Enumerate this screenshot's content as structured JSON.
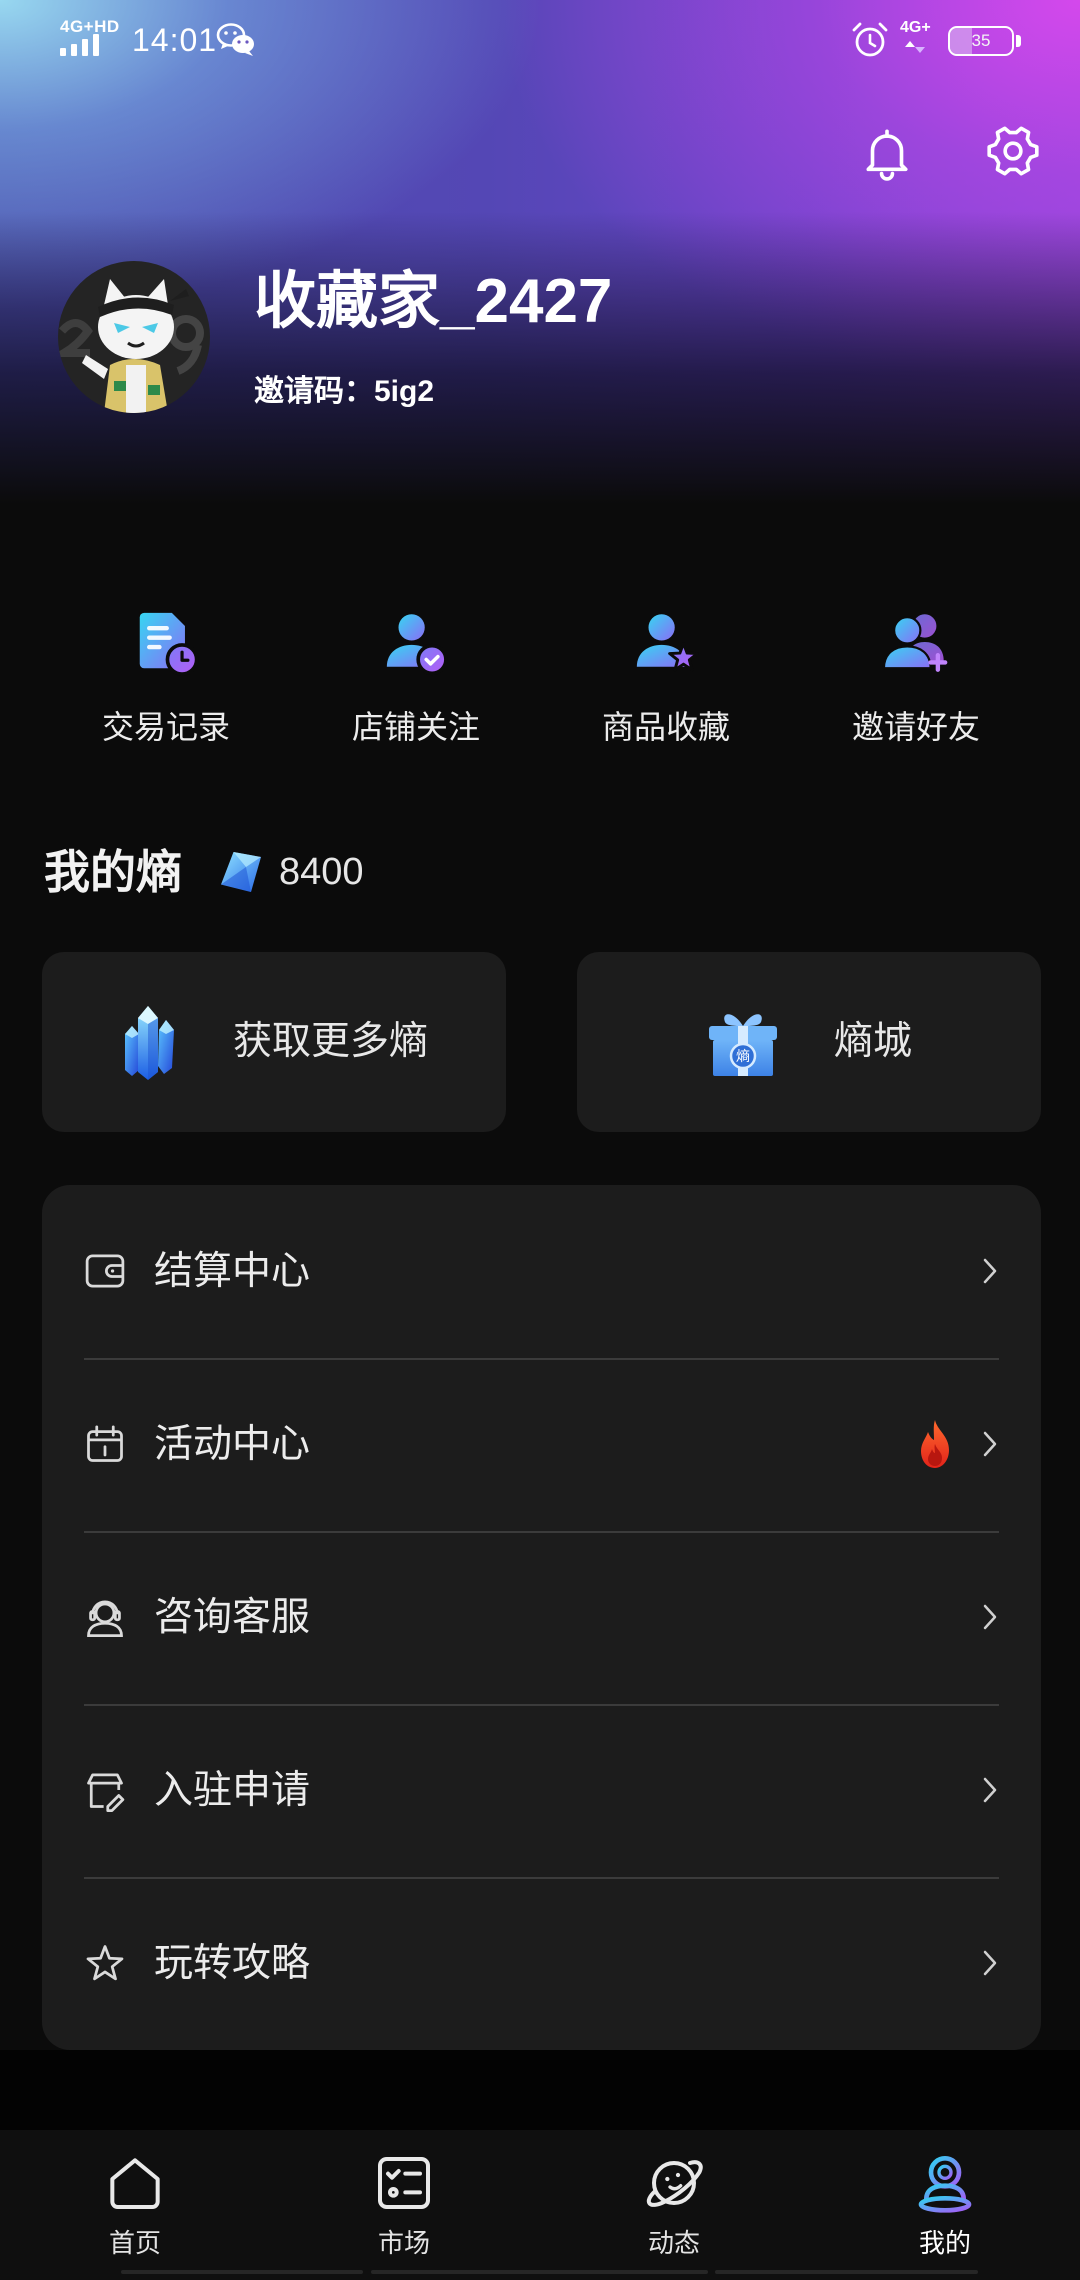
{
  "status_bar": {
    "network_label": "4G+HD",
    "time": "14:01",
    "network_right_label": "4G+",
    "battery_level": "35"
  },
  "header": {
    "icons": [
      "bell-icon",
      "gear-icon"
    ]
  },
  "profile": {
    "username": "收藏家_2427",
    "invite_label": "邀请码：",
    "invite_code": "5ig2"
  },
  "quick_actions": [
    {
      "label": "交易记录",
      "icon": "transaction-record-icon"
    },
    {
      "label": "店铺关注",
      "icon": "followed-shops-icon"
    },
    {
      "label": "商品收藏",
      "icon": "favorite-items-icon"
    },
    {
      "label": "邀请好友",
      "icon": "invite-friends-icon"
    }
  ],
  "entropy": {
    "title": "我的熵",
    "balance": "8400",
    "balance_icon": "entropy-gem-icon",
    "cards": [
      {
        "label": "获取更多熵",
        "icon": "crystal-cluster-icon"
      },
      {
        "label": "熵城",
        "icon": "gift-box-icon",
        "icon_text": "熵"
      }
    ]
  },
  "menu": [
    {
      "label": "结算中心",
      "icon": "wallet-icon"
    },
    {
      "label": "活动中心",
      "icon": "activity-box-icon",
      "badge_icon": "fire-icon"
    },
    {
      "label": "咨询客服",
      "icon": "customer-service-icon"
    },
    {
      "label": "入驻申请",
      "icon": "store-apply-icon"
    },
    {
      "label": "玩转攻略",
      "icon": "star-icon"
    }
  ],
  "bottom_nav": {
    "items": [
      {
        "label": "首页",
        "icon": "home-icon",
        "active": false
      },
      {
        "label": "市场",
        "icon": "market-icon",
        "active": false
      },
      {
        "label": "动态",
        "icon": "planet-icon",
        "active": false
      },
      {
        "label": "我的",
        "icon": "profile-icon",
        "active": true
      }
    ]
  },
  "colors": {
    "background": "#0b0b0b",
    "card": "#1c1c1c",
    "divider": "#3b3b3b",
    "accent_start": "#36d6f2",
    "accent_end": "#a45cf6",
    "hot": "#ff3b1f"
  }
}
